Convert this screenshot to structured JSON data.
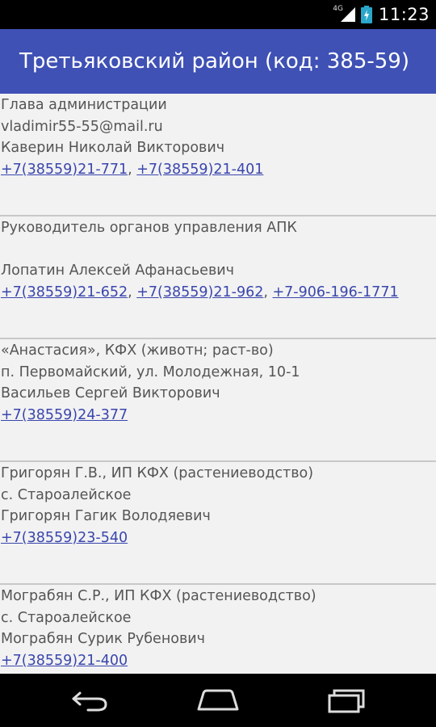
{
  "status_bar": {
    "network_label": "4G",
    "time": "11:23",
    "icons": [
      "signal-icon",
      "battery-charging-icon"
    ]
  },
  "app_bar": {
    "title": "Третьяковский район (код: 385-59)"
  },
  "entries": [
    {
      "lines": [
        "Глава администрации",
        "vladimir55-55@mail.ru",
        "Каверин Николай Викторович"
      ],
      "phones": [
        "+7(38559)21-771",
        "+7(38559)21-401"
      ]
    },
    {
      "lines": [
        "Руководитель органов управления АПК",
        "",
        "Лопатин Алексей Афанасьевич"
      ],
      "phones": [
        "+7(38559)21-652",
        "+7(38559)21-962",
        "+7-906-196-1771"
      ]
    },
    {
      "lines": [
        "«Анастасия», КФХ (животн; раст-во)",
        "п. Первомайский, ул. Молодежная, 10-1",
        "Васильев Сергей Викторович"
      ],
      "phones": [
        "+7(38559)24-377"
      ]
    },
    {
      "lines": [
        "Григорян Г.В., ИП КФХ (растениеводство)",
        "с. Староалейское",
        "Григорян Гагик Володяевич"
      ],
      "phones": [
        "+7(38559)23-540"
      ]
    },
    {
      "lines": [
        "Мограбян С.Р., ИП КФХ (растениеводство)",
        "с. Староалейское",
        "Мограбян Сурик Рубенович"
      ],
      "phones": [
        "+7(38559)21-400"
      ]
    }
  ],
  "phone_separator": ", ",
  "nav_bar": {
    "icons": [
      "back-icon",
      "home-icon",
      "recent-apps-icon"
    ]
  },
  "colors": {
    "app_bar": "#3f51b5",
    "link": "#3a46ad",
    "text": "#555555",
    "divider": "#c8c8c8",
    "background": "#f2f2f2"
  }
}
